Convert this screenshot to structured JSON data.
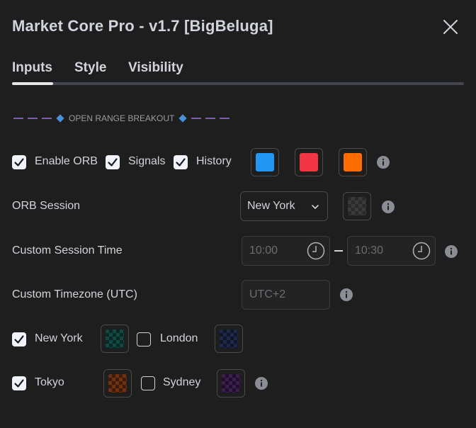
{
  "dialog": {
    "title": "Market Core Pro - v1.7 [BigBeluga]"
  },
  "tabs": [
    {
      "label": "Inputs",
      "active": true
    },
    {
      "label": "Style",
      "active": false
    },
    {
      "label": "Visibility",
      "active": false
    }
  ],
  "section": {
    "label": "OPEN RANGE BREAKOUT"
  },
  "orb": {
    "enable_label": "Enable ORB",
    "enable_checked": true,
    "signals_label": "Signals",
    "signals_checked": true,
    "history_label": "History",
    "history_checked": true,
    "colors": [
      "#2196f3",
      "#f23645",
      "#ff6d00"
    ]
  },
  "session": {
    "label": "ORB Session",
    "value": "New York"
  },
  "custom_time": {
    "label": "Custom Session Time",
    "start": "10:00",
    "end": "10:30"
  },
  "custom_tz": {
    "label": "Custom Timezone (UTC)",
    "placeholder": "UTC+2"
  },
  "sessions": [
    {
      "label": "New York",
      "checked": true,
      "color": "#00897b"
    },
    {
      "label": "London",
      "checked": false,
      "color": "#1e3a8a"
    },
    {
      "label": "Tokyo",
      "checked": true,
      "color": "#e65100"
    },
    {
      "label": "Sydney",
      "checked": false,
      "color": "#6a1b9a"
    }
  ],
  "colors": {
    "background": "#1e1e1e",
    "text": "#d1d4dc",
    "accent_purple": "#7e57c2",
    "accent_blue": "#4a90d9"
  },
  "icons": [
    "close-icon",
    "check-icon",
    "info-icon",
    "chevron-down-icon",
    "clock-icon"
  ]
}
